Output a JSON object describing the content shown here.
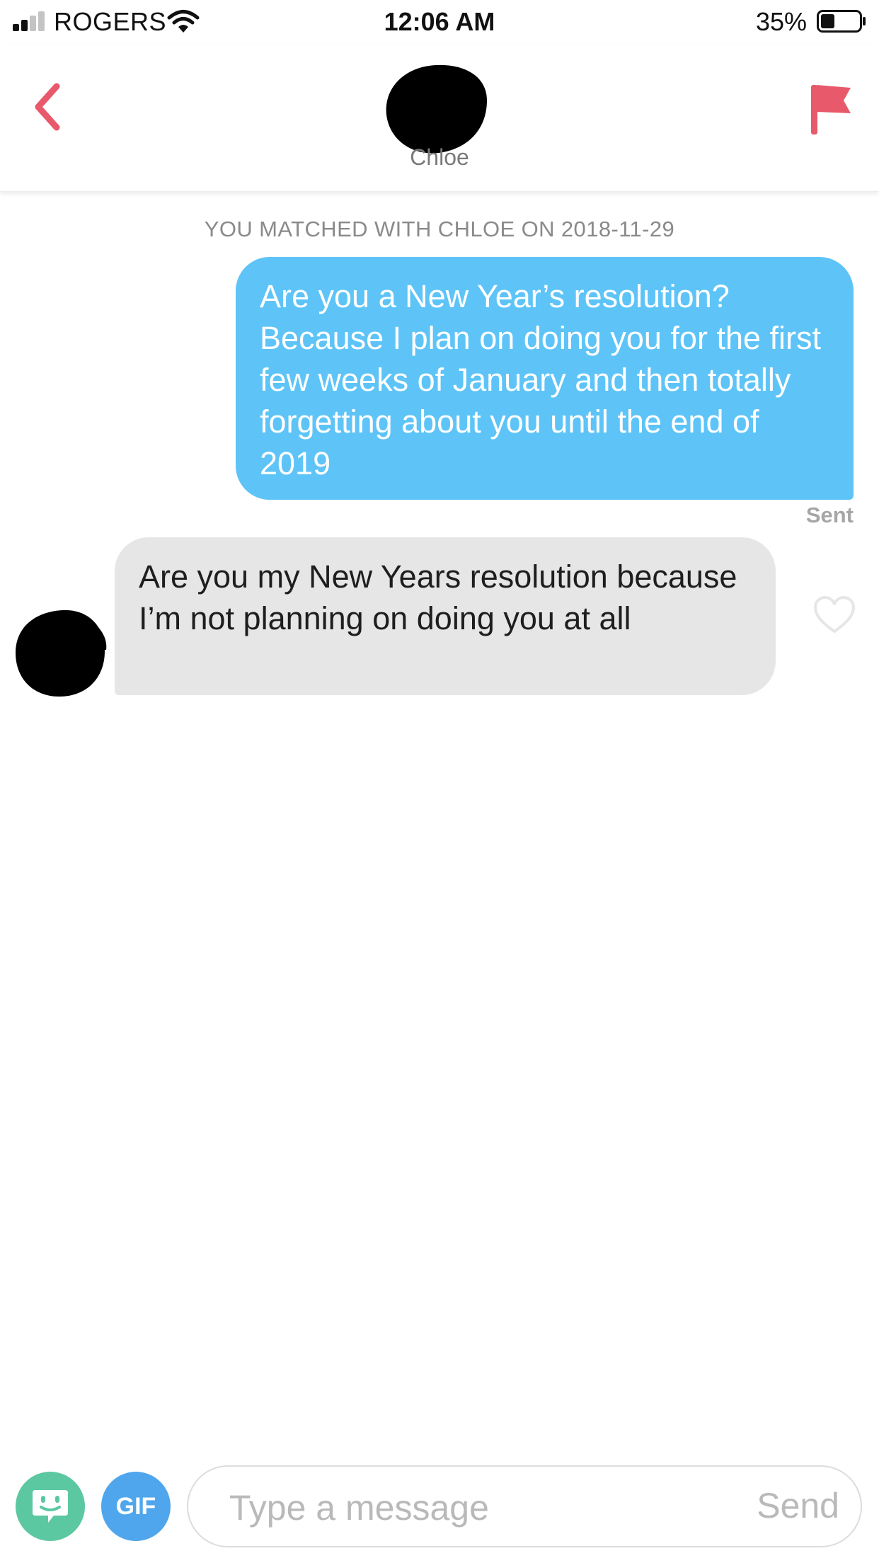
{
  "status_bar": {
    "carrier": "ROGERS",
    "time": "12:06 AM",
    "battery_percent": "35%",
    "battery_level": 0.35,
    "signal_bars_filled": 2,
    "signal_bars_total": 4
  },
  "header": {
    "match_name": "Chloe",
    "back_icon": "chevron-left-icon",
    "flag_icon": "report-flag-icon",
    "accent_color": "#e8596b"
  },
  "conversation": {
    "match_info": "YOU MATCHED WITH CHLOE ON 2018-11-29",
    "messages": [
      {
        "direction": "sent",
        "text": "Are you a New Year’s resolution? Because I plan on doing you for the first few weeks of January and then totally forgetting about you until the end of 2019",
        "status": "Sent",
        "bubble_color": "#5ec4f7"
      },
      {
        "direction": "received",
        "text": "Are you my New Years resolution because I’m not planning on doing you at all",
        "bubble_color": "#e6e6e6",
        "like_icon": "heart-outline-icon"
      }
    ]
  },
  "composer": {
    "sticker_icon": "sticker-face-icon",
    "gif_label": "GIF",
    "placeholder": "Type a message",
    "send_label": "Send"
  }
}
